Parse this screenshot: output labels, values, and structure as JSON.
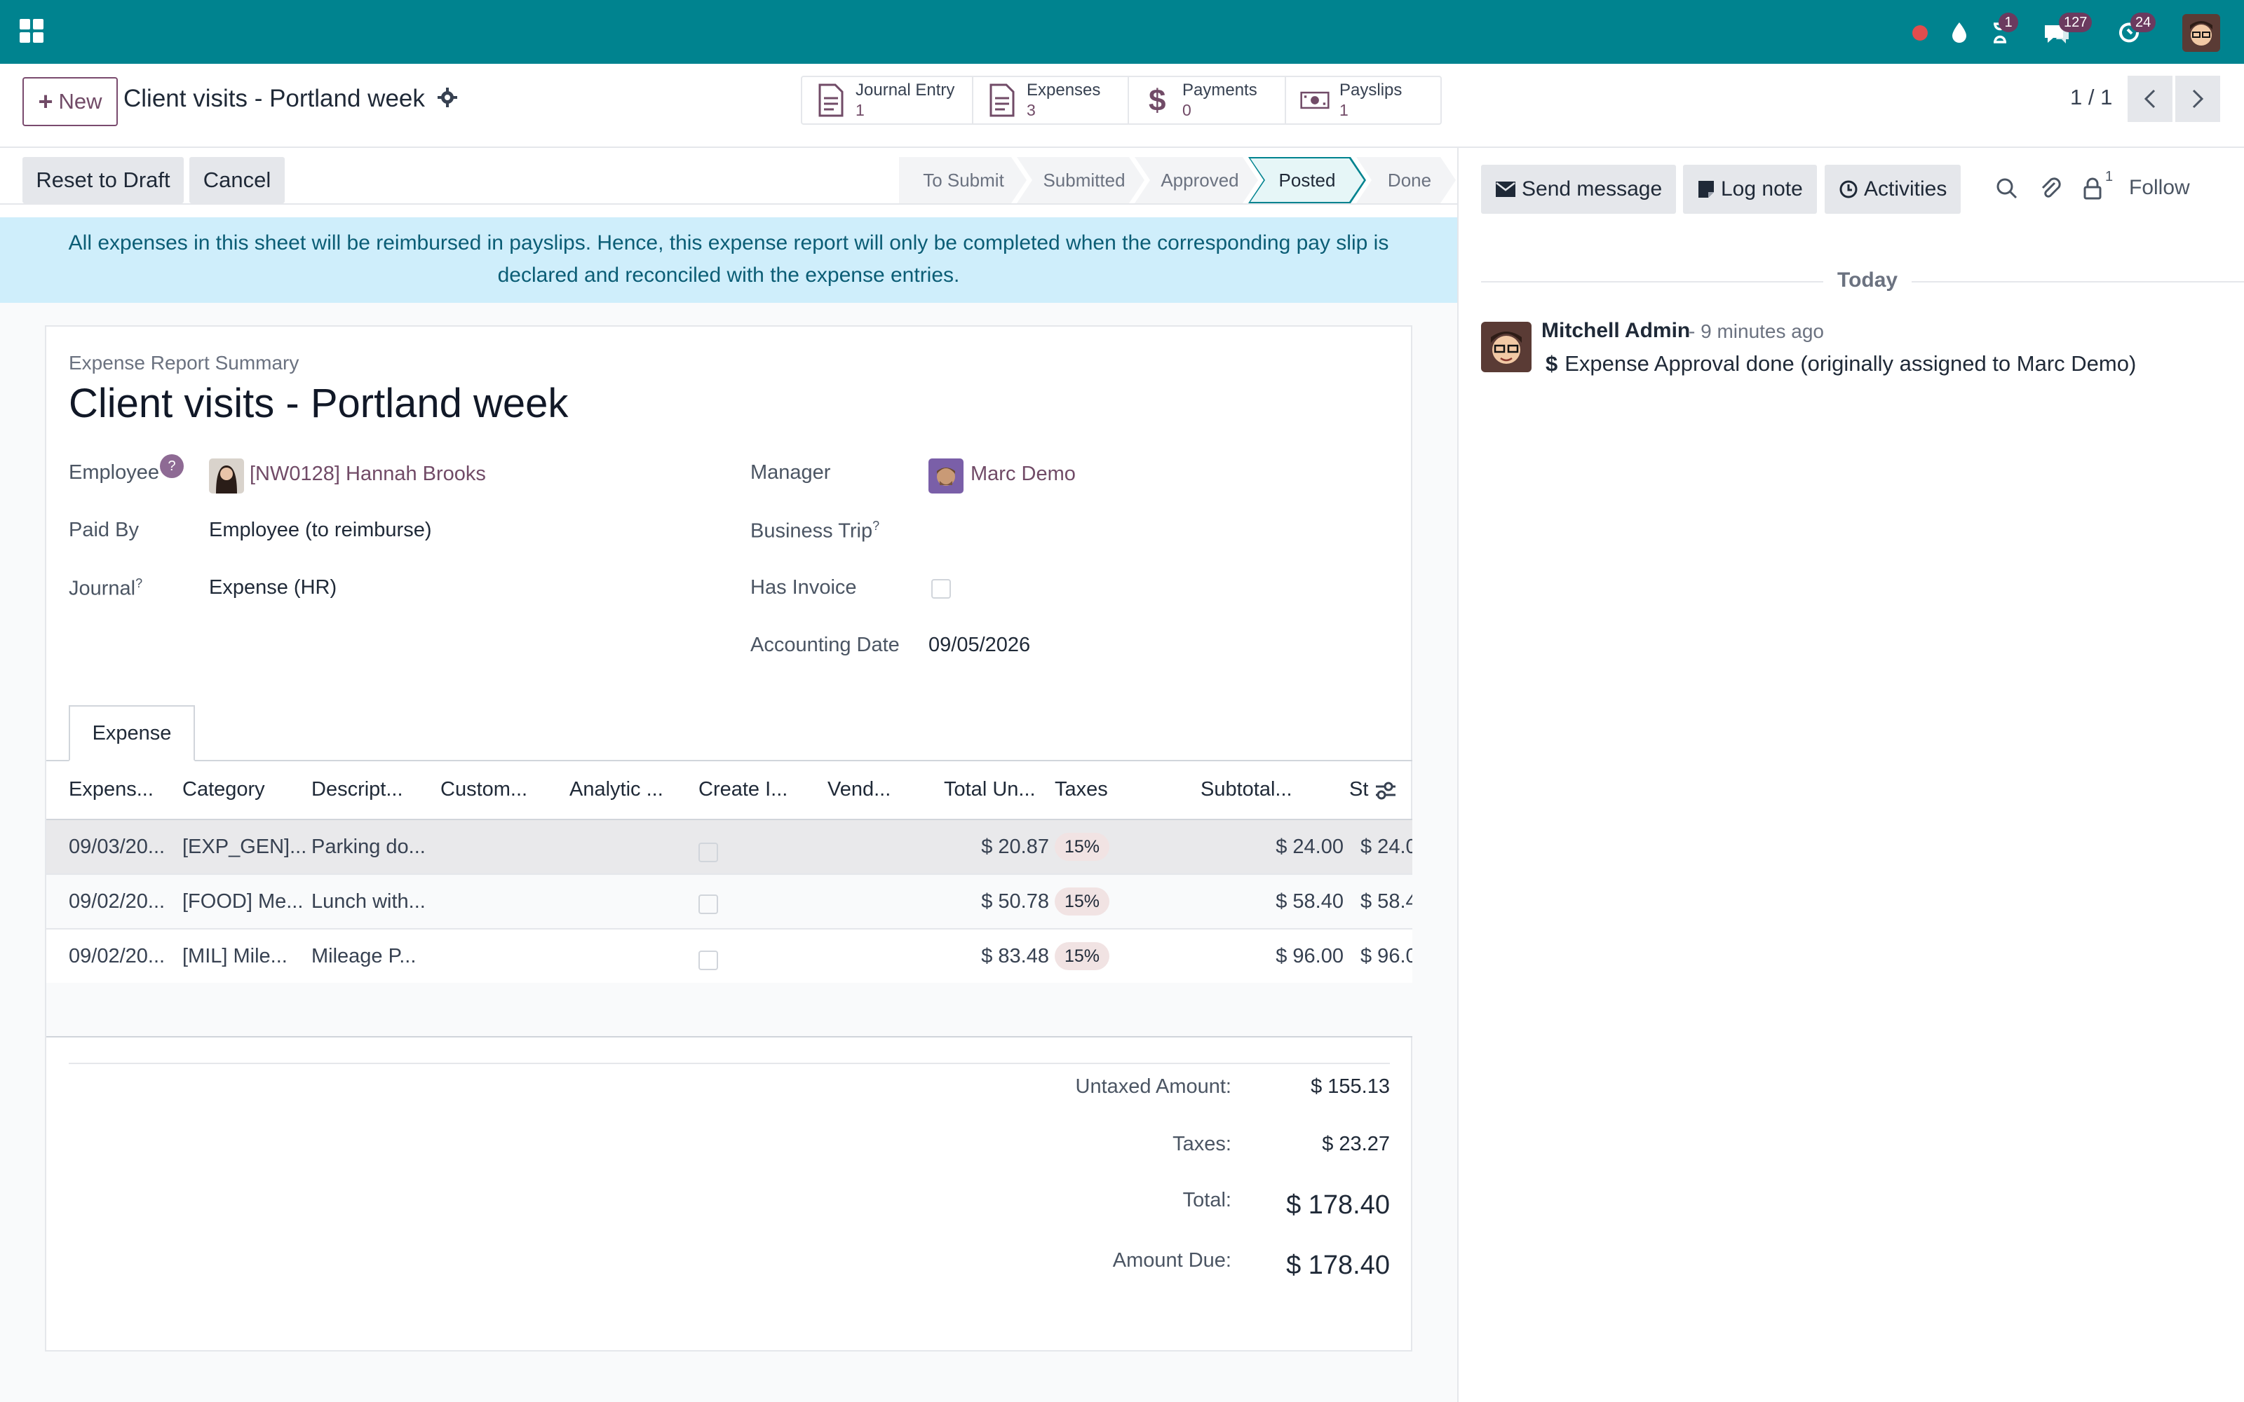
{
  "topbar": {
    "badges": {
      "activity": "1",
      "messages": "127",
      "updates": "24"
    }
  },
  "control": {
    "new_label": "New",
    "record_title": "Client visits - Portland week",
    "pager": "1 / 1"
  },
  "smart_buttons": [
    {
      "label": "Journal Entry",
      "value": "1"
    },
    {
      "label": "Expenses",
      "value": "3"
    },
    {
      "label": "Payments",
      "value": "0"
    },
    {
      "label": "Payslips",
      "value": "1"
    }
  ],
  "actions": {
    "reset": "Reset to Draft",
    "cancel": "Cancel"
  },
  "stages": [
    "To Submit",
    "Submitted",
    "Approved",
    "Posted",
    "Done"
  ],
  "active_stage": "Posted",
  "alert": {
    "line1": "All expenses in this sheet will be reimbursed in payslips. Hence, this expense report will only be completed when the corresponding pay slip is",
    "line2": "declared and reconciled with the expense entries."
  },
  "form": {
    "subtitle": "Expense Report Summary",
    "title": "Client visits - Portland week",
    "employee_label": "Employee",
    "employee_value": "[NW0128] Hannah Brooks",
    "paid_by_label": "Paid By",
    "paid_by_value": "Employee (to reimburse)",
    "journal_label": "Journal",
    "journal_value": "Expense (HR)",
    "manager_label": "Manager",
    "manager_value": "Marc Demo",
    "business_trip_label": "Business Trip",
    "has_invoice_label": "Has Invoice",
    "accounting_date_label": "Accounting Date",
    "accounting_date_value": "09/05/2026",
    "help_mark": "?",
    "tooltip_mark": "?"
  },
  "tab": {
    "label": "Expense"
  },
  "table": {
    "headers": [
      "Expens...",
      "Category",
      "Descript...",
      "Custom...",
      "Analytic ...",
      "Create I...",
      "Vend...",
      "Total Un...",
      "Taxes",
      "Subtotal...",
      "St"
    ],
    "rows": [
      {
        "date": "09/03/20...",
        "category": "[EXP_GEN]...",
        "description": "Parking do...",
        "total": "$ 20.87",
        "tax": "15%",
        "subtotal": "$ 24.00",
        "st": "$ 24.0"
      },
      {
        "date": "09/02/20...",
        "category": "[FOOD] Me...",
        "description": "Lunch with...",
        "total": "$ 50.78",
        "tax": "15%",
        "subtotal": "$ 58.40",
        "st": "$ 58.4"
      },
      {
        "date": "09/02/20...",
        "category": "[MIL] Mile...",
        "description": "Mileage P...",
        "total": "$ 83.48",
        "tax": "15%",
        "subtotal": "$ 96.00",
        "st": "$ 96.0"
      }
    ]
  },
  "totals": {
    "untaxed_label": "Untaxed Amount:",
    "untaxed_value": "$ 155.13",
    "taxes_label": "Taxes:",
    "taxes_value": "$ 23.27",
    "total_label": "Total:",
    "total_value": "$ 178.40",
    "due_label": "Amount Due:",
    "due_value": "$ 178.40"
  },
  "chatter": {
    "send_message": "Send message",
    "log_note": "Log note",
    "activities": "Activities",
    "followers_count": "1",
    "follow": "Follow",
    "date_separator": "Today",
    "message": {
      "author": "Mitchell Admin",
      "time": "- 9 minutes ago",
      "body": "Expense Approval done (originally assigned to Marc Demo)"
    }
  },
  "colors": {
    "brand": "#00838f",
    "accent": "#714b67",
    "alert_bg": "#cfeefb"
  }
}
